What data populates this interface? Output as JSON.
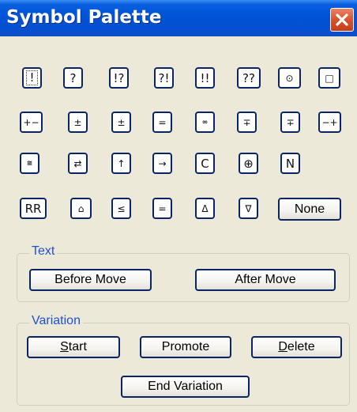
{
  "window": {
    "title": "Symbol Palette",
    "close_icon": "close-x-icon"
  },
  "symbols": [
    [
      "!",
      "?",
      "!?",
      "?!",
      "!!",
      "??",
      "⊙",
      "□"
    ],
    [
      "+−",
      "±",
      "±",
      "=",
      "∞",
      "∓",
      "∓",
      "−+"
    ],
    [
      "≅",
      "⇄",
      "↑",
      "→",
      "C",
      "⊕",
      "N"
    ],
    [
      "RR",
      "⌂",
      "≤",
      "=",
      "Δ",
      "∇"
    ]
  ],
  "none_label": "None",
  "text_group": {
    "label": "Text",
    "before_move": "Before Move",
    "after_move": "After Move"
  },
  "variation_group": {
    "label": "Variation",
    "start_mnemonic": "S",
    "start_rest": "tart",
    "promote": "Promote",
    "delete_mnemonic": "D",
    "delete_rest": "elete",
    "end_variation": "End Variation"
  },
  "colors": {
    "titlebar": "#0052d6",
    "close_button": "#d9532d",
    "dialog_bg": "#ece9d8",
    "button_border": "#0a2566",
    "group_label": "#1f4fd0"
  }
}
